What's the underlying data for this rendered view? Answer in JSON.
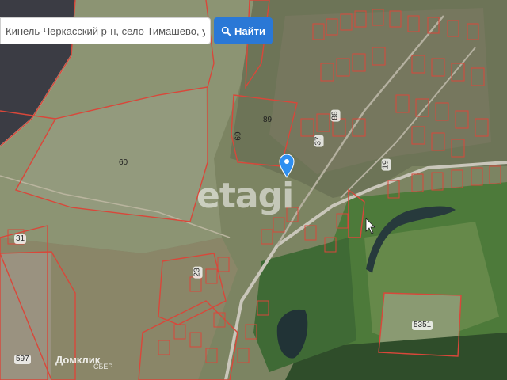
{
  "search": {
    "value": "Кинель-Черкасский р-н, село Тимашево, ул",
    "button_label": "Найти"
  },
  "map": {
    "parcel_labels": {
      "p31": "31",
      "p60": "60",
      "p89": "89",
      "p88": "88",
      "p69": "69",
      "p37": "37",
      "p19": "19",
      "p23": "23",
      "p597": "597",
      "p5351": "5351"
    },
    "marker_icon": "location-pin-icon"
  },
  "watermark": "etagi",
  "brand": {
    "name": "Домклик",
    "sub": "СБЕР"
  },
  "colors": {
    "parcel_border": "#d9473a",
    "button": "#2a78d6",
    "pin": "#2f8ff0"
  }
}
